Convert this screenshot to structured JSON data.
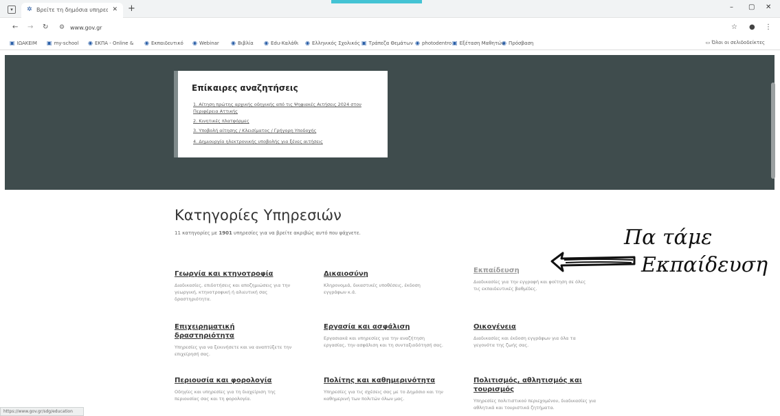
{
  "browser": {
    "tab_title": "Βρείτε τη δημόσια υπηρεσία π",
    "url": "www.gov.gr",
    "bookmarks": [
      "ΙΩΑΚΕΙΜ",
      "my-school",
      "ΕΚΠΑ - Online &",
      "Εκπαιδευτικό",
      "Webinar",
      "Βιβλία",
      "Edu-Καλάθι",
      "Ελληνικός Σχολικός",
      "Τράπεζα Θεμάτων",
      "photodentro",
      "Εξέταση Μαθητών",
      "Πρόσβαση"
    ],
    "all_bookmarks": "Όλοι οι σελιδοδείκτες"
  },
  "popular": {
    "title": "Επίκαιρες αναζητήσεις",
    "links": [
      "1. Αίτηση πρώτης αρχικής οδηγικής από τις Ψηφιακές Αιτήσεις 2024 στον Περιφέρεια Αττικής",
      "2. Κινητικές πλατφόρμες",
      "3. Υποβολή αίτησης / Κλεισίματος / Γρήγορη Υποδοχής",
      "4. Δημιουργία ηλεκτρονικής υποβολής για ξένες αιτήσεις"
    ]
  },
  "categories_section": {
    "title": "Κατηγορίες Υπηρεσιών",
    "subtitle_pre": "11 κατηγορίες με ",
    "subtitle_count": "1901",
    "subtitle_post": " υπηρεσίες για να βρείτε ακριβώς αυτό που ψάχνετε."
  },
  "categories": [
    {
      "title": "Γεωργία και κτηνοτροφία",
      "desc": "Διαδικασίες, επιδοτήσεις και αποζημιώσεις για την γεωργική, κτηνοτροφική ή αλιευτική σας δραστηριότητα."
    },
    {
      "title": "Δικαιοσύνη",
      "desc": "Κληρονομιά, δικαστικές υποθέσεις, έκδοση εγγράφων κ.ά."
    },
    {
      "title": "Εκπαίδευση",
      "desc": "Διαδικασίες για την εγγραφή και φοίτηση σε όλες τις εκπαιδευτικές βαθμίδες."
    },
    {
      "title": "Επιχειρηματική δραστηριότητα",
      "desc": "Υπηρεσίες για να ξεκινήσετε και να αναπτύξετε την επιχείρησή σας."
    },
    {
      "title": "Εργασία και ασφάλιση",
      "desc": "Εργασιακά και υπηρεσίες για την αναζήτηση εργασίας, την ασφάλιση και τη συνταξιοδότησή σας."
    },
    {
      "title": "Οικογένεια",
      "desc": "Διαδικασίες και έκδοση εγγράφων για όλα τα γεγονότα της ζωής σας."
    },
    {
      "title": "Περιουσία και φορολογία",
      "desc": "Οδηγίες και υπηρεσίες για τη διαχείριση της περιουσίας σας και τη φορολογία."
    },
    {
      "title": "Πολίτης και καθημερινότητα",
      "desc": "Υπηρεσίες για τις σχέσεις σας με το Δημόσιο και την καθημερινή των πολιτών όλων μας."
    },
    {
      "title": "Πολιτισμός, αθλητισμός και τουρισμός",
      "desc": "Υπηρεσίες πολιτιστικού περιεχομένου, διαδικασίες για αθλητικά και τουριστικά ζητήματα."
    }
  ],
  "status_url": "https://www.gov.gr/sdg/education",
  "annotation": {
    "line1": "Πα τάμε",
    "line2": "Εκπαίδευση"
  },
  "colors": {
    "hero_bg": "#3f4c4d",
    "accent_strip": "#44c3d4"
  }
}
